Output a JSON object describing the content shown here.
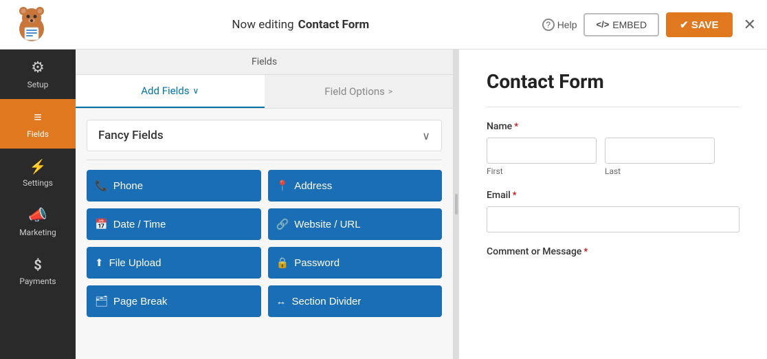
{
  "topbar": {
    "editing_prefix": "Now editing",
    "form_name": "Contact Form",
    "help_label": "Help",
    "embed_label": "EMBED",
    "save_label": "✔ SAVE",
    "close_label": "✕"
  },
  "sidebar": {
    "items": [
      {
        "id": "setup",
        "label": "Setup",
        "icon": "⚙",
        "active": false
      },
      {
        "id": "fields",
        "label": "Fields",
        "icon": "☰",
        "active": true
      },
      {
        "id": "settings",
        "label": "Settings",
        "icon": "⚡",
        "active": false
      },
      {
        "id": "marketing",
        "label": "Marketing",
        "icon": "📣",
        "active": false
      },
      {
        "id": "payments",
        "label": "Payments",
        "icon": "$",
        "active": false
      }
    ]
  },
  "fields_panel": {
    "header": "Fields",
    "tabs": [
      {
        "id": "add-fields",
        "label": "Add Fields",
        "active": true
      },
      {
        "id": "field-options",
        "label": "Field Options",
        "active": false
      }
    ],
    "fancy_fields": {
      "label": "Fancy Fields",
      "buttons": [
        {
          "id": "phone",
          "label": "Phone",
          "icon": "📞"
        },
        {
          "id": "address",
          "label": "Address",
          "icon": "📍"
        },
        {
          "id": "date-time",
          "label": "Date / Time",
          "icon": "📅"
        },
        {
          "id": "website-url",
          "label": "Website / URL",
          "icon": "🔗"
        },
        {
          "id": "file-upload",
          "label": "File Upload",
          "icon": "⬆"
        },
        {
          "id": "password",
          "label": "Password",
          "icon": "🔒"
        },
        {
          "id": "page-break",
          "label": "Page Break",
          "icon": "🗂"
        },
        {
          "id": "section-divider",
          "label": "Section Divider",
          "icon": "↔"
        }
      ]
    }
  },
  "form_preview": {
    "title": "Contact Form",
    "fields": [
      {
        "id": "name",
        "label": "Name",
        "required": true,
        "type": "name",
        "subfields": [
          {
            "placeholder": "",
            "sublabel": "First"
          },
          {
            "placeholder": "",
            "sublabel": "Last"
          }
        ]
      },
      {
        "id": "email",
        "label": "Email",
        "required": true,
        "type": "email"
      },
      {
        "id": "comment",
        "label": "Comment or Message",
        "required": true,
        "type": "textarea"
      }
    ]
  }
}
